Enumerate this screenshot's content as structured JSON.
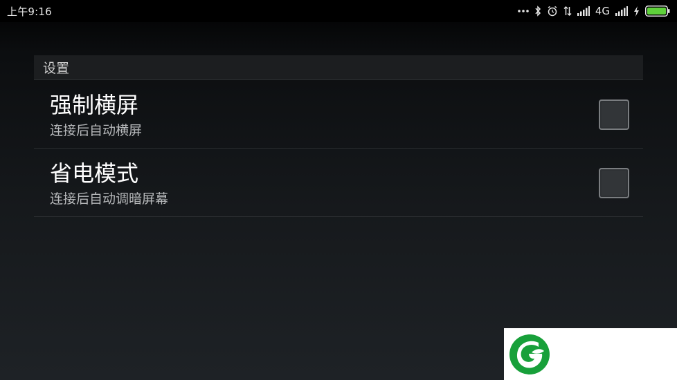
{
  "status_bar": {
    "time": "上午9:16",
    "network": "4G",
    "icons": [
      "more-dots-icon",
      "bluetooth-icon",
      "alarm-icon",
      "data-arrows-icon",
      "signal-icon",
      "signal-icon-2",
      "charging-icon",
      "battery-icon"
    ],
    "battery_color": "#5fd13b"
  },
  "settings": {
    "section_title": "设置",
    "items": [
      {
        "title": "强制横屏",
        "subtitle": "连接后自动横屏",
        "checked": false
      },
      {
        "title": "省电模式",
        "subtitle": "连接后自动调暗屏幕",
        "checked": false
      }
    ]
  },
  "watermark": {
    "logo": "green-g-leaf-logo",
    "brand_color": "#18a03a"
  }
}
